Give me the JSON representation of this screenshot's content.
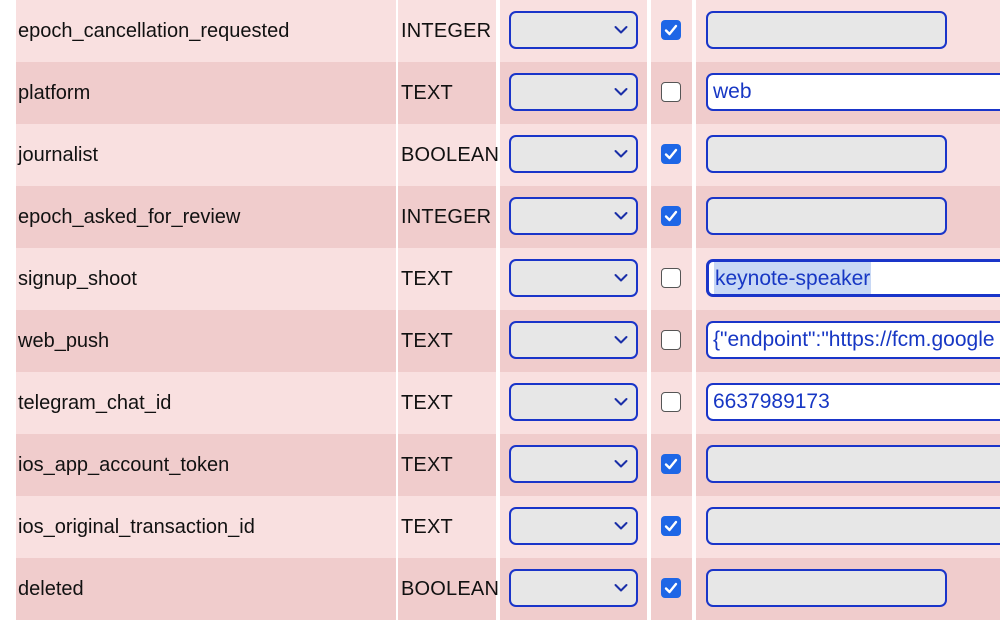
{
  "rows": [
    {
      "name": "epoch_cancellation_requested",
      "type": "INTEGER",
      "function": "",
      "null_checked": true,
      "value": "",
      "field": "short"
    },
    {
      "name": "platform",
      "type": "TEXT",
      "function": "",
      "null_checked": false,
      "value": "web",
      "field": "long"
    },
    {
      "name": "journalist",
      "type": "BOOLEAN",
      "function": "",
      "null_checked": true,
      "value": "",
      "field": "short"
    },
    {
      "name": "epoch_asked_for_review",
      "type": "INTEGER",
      "function": "",
      "null_checked": true,
      "value": "",
      "field": "short"
    },
    {
      "name": "signup_shoot",
      "type": "TEXT",
      "function": "",
      "null_checked": false,
      "value": "keynote-speaker",
      "field": "long",
      "selected": true
    },
    {
      "name": "web_push",
      "type": "TEXT",
      "function": "",
      "null_checked": false,
      "value": "{\"endpoint\":\"https://fcm.google",
      "field": "long",
      "multiline": true
    },
    {
      "name": "telegram_chat_id",
      "type": "TEXT",
      "function": "",
      "null_checked": false,
      "value": "6637989173",
      "field": "long"
    },
    {
      "name": "ios_app_account_token",
      "type": "TEXT",
      "function": "",
      "null_checked": true,
      "value": "",
      "field": "long"
    },
    {
      "name": "ios_original_transaction_id",
      "type": "TEXT",
      "function": "",
      "null_checked": true,
      "value": "",
      "field": "long"
    },
    {
      "name": "deleted",
      "type": "BOOLEAN",
      "function": "",
      "null_checked": true,
      "value": "",
      "field": "short"
    }
  ],
  "colors": {
    "row_light": "#f9e0e0",
    "row_dark": "#f0cccc",
    "control_border": "#1a35c9",
    "control_bg": "#e7e7e7",
    "checkbox_on": "#1e66e6",
    "value_text": "#1737c4"
  },
  "icons": {
    "select_arrow": "chevron-down-icon",
    "checkbox_mark": "checkmark-icon"
  }
}
